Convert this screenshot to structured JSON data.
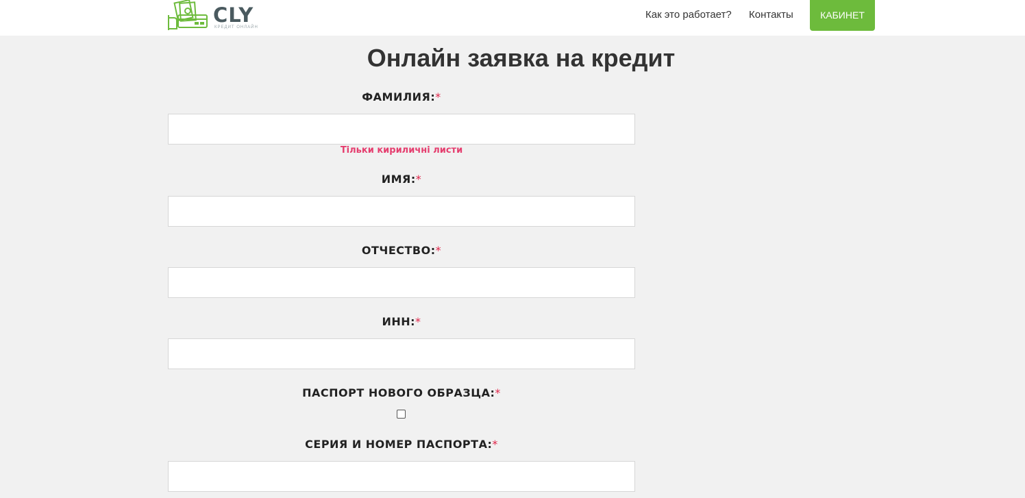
{
  "header": {
    "logo_text": "CLY",
    "logo_subtitle": "КРЕДИТ ОНЛАЙН",
    "nav": {
      "how_it_works": "Как это работает?",
      "contacts": "Контакты"
    },
    "cabinet_button": "КАБИНЕТ"
  },
  "form": {
    "title": "Онлайн заявка на кредит",
    "required_mark": "*",
    "fields": {
      "surname": {
        "label": "ФАМИЛИЯ:",
        "value": "",
        "hint": "Тільки кириличні листи"
      },
      "name": {
        "label": "ИМЯ:",
        "value": ""
      },
      "patronymic": {
        "label": "ОТЧЕСТВО:",
        "value": ""
      },
      "inn": {
        "label": "ИНН:",
        "value": ""
      },
      "new_passport": {
        "label": "ПАСПОРТ НОВОГО ОБРАЗЦА:",
        "checked": false
      },
      "passport_number": {
        "label": "СЕРИЯ И НОМЕР ПАСПОРТА:",
        "value": ""
      }
    }
  },
  "colors": {
    "accent": "#6dbb3c",
    "required": "#e0254a",
    "hint": "#e53d6e",
    "background": "#f1f1f1"
  }
}
